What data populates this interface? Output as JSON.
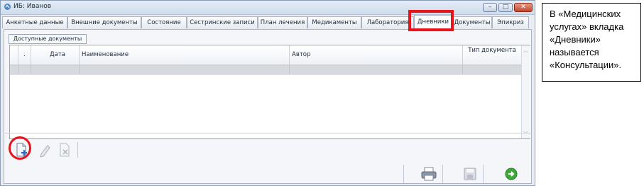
{
  "window": {
    "title": "ИБ: Иванов",
    "controls": {
      "minimize": "–",
      "maximize": "□",
      "close": "✕"
    }
  },
  "tabs": [
    {
      "label": "Анкетные данные"
    },
    {
      "label": "Внешние документы"
    },
    {
      "label": "Состояние"
    },
    {
      "label": "Сестринские записи"
    },
    {
      "label": "План лечения"
    },
    {
      "label": "Медикаменты"
    },
    {
      "label": "Лаборатория"
    },
    {
      "label": "Дневники",
      "active": true
    },
    {
      "label": "Документы"
    },
    {
      "label": "Эпикриз"
    }
  ],
  "subtab": {
    "label": "Доступные документы"
  },
  "grid": {
    "columns": [
      {
        "label": "."
      },
      {
        "label": "Дата"
      },
      {
        "label": "Наименование"
      },
      {
        "label": "Автор"
      },
      {
        "label": "Тип документа"
      }
    ],
    "rows": [
      [
        "",
        "",
        "",
        "",
        ""
      ]
    ]
  },
  "toolbar": {
    "buttons": [
      {
        "icon": "new-document-icon",
        "label": ""
      },
      {
        "icon": "edit-pencil-icon",
        "label": ""
      },
      {
        "icon": "delete-document-icon",
        "label": ""
      }
    ]
  },
  "footer": {
    "buttons": [
      {
        "icon": "printer-icon"
      },
      {
        "icon": "save-disk-icon"
      },
      {
        "icon": "exit-arrow-icon"
      }
    ]
  },
  "note": {
    "lines": [
      "В «Медицинских",
      "услугах» вкладка",
      "«Дневники»",
      "называется",
      "«Консультации»."
    ]
  },
  "colors": {
    "highlight": "#e8141c",
    "exit_green": "#3ea83a"
  }
}
